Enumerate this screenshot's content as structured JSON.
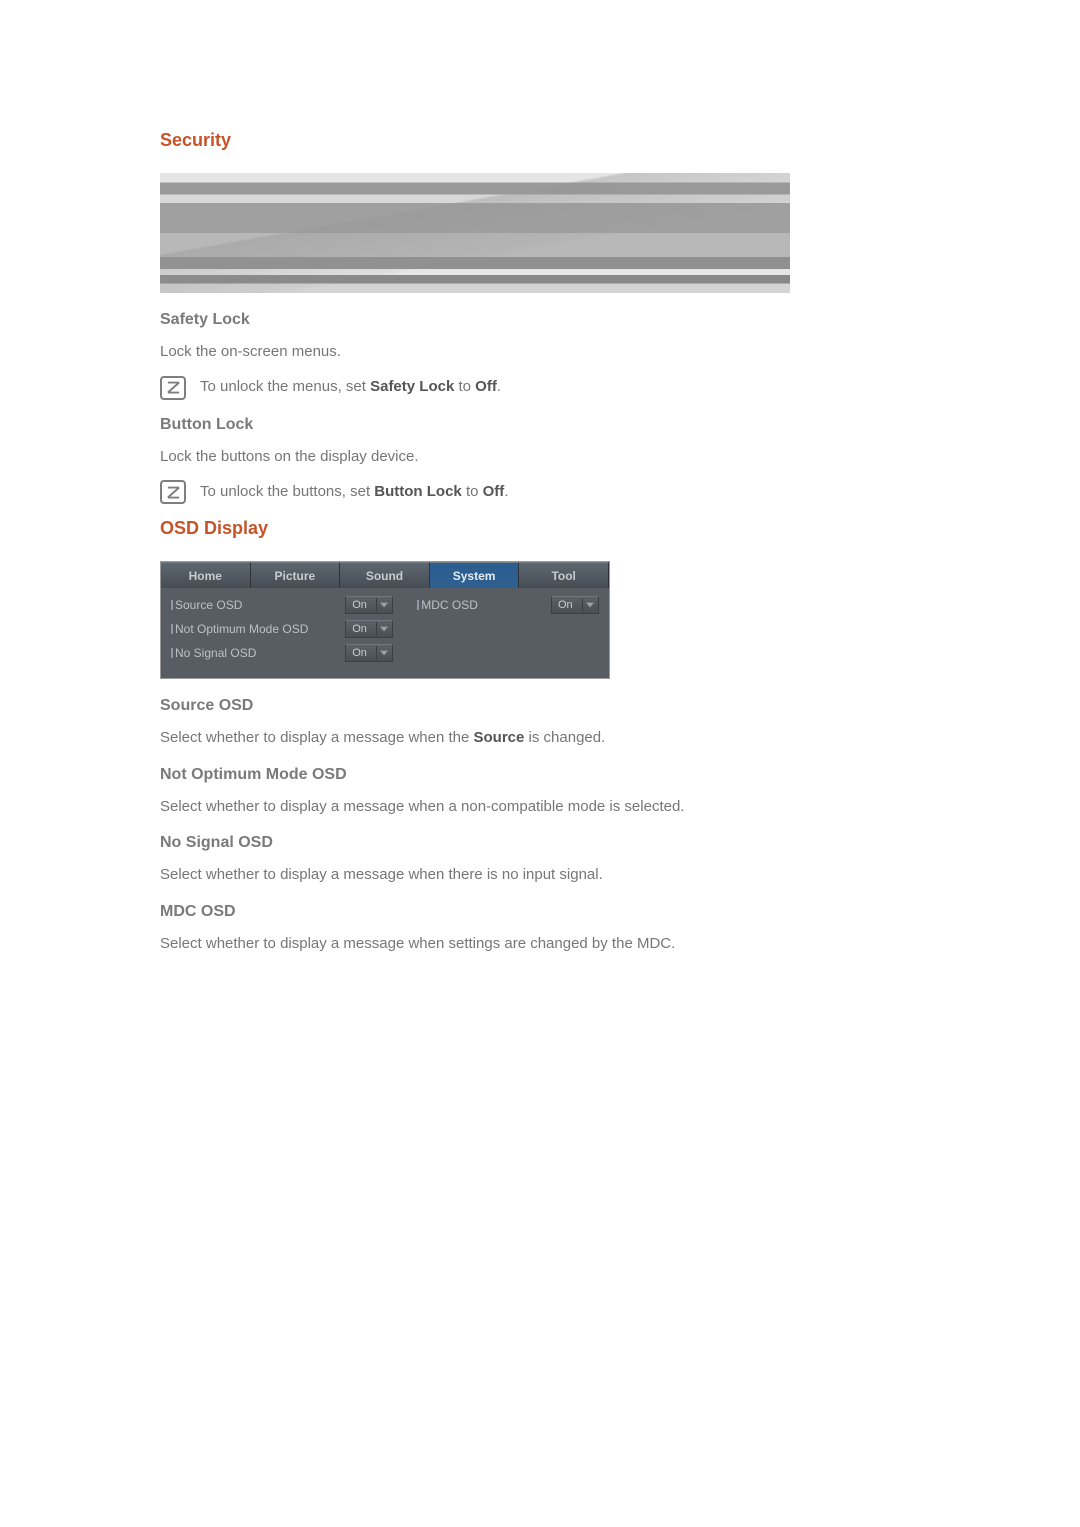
{
  "security": {
    "heading": "Security",
    "safety_lock": {
      "title": "Safety Lock",
      "desc": "Lock the on-screen menus.",
      "note_pre": "To unlock the menus, set ",
      "note_bold1": "Safety Lock",
      "note_mid": " to ",
      "note_bold2": "Off",
      "note_post": "."
    },
    "button_lock": {
      "title": "Button Lock",
      "desc": "Lock the buttons on the display device.",
      "note_pre": "To unlock the buttons, set ",
      "note_bold1": "Button Lock",
      "note_mid": " to ",
      "note_bold2": "Off",
      "note_post": "."
    }
  },
  "osd": {
    "heading": "OSD Display",
    "tabs": {
      "home": "Home",
      "picture": "Picture",
      "sound": "Sound",
      "system": "System",
      "tool": "Tool"
    },
    "rows": {
      "source_osd": {
        "label": "Source OSD",
        "value": "On"
      },
      "not_optimum": {
        "label": "Not Optimum Mode OSD",
        "value": "On"
      },
      "no_signal": {
        "label": "No Signal OSD",
        "value": "On"
      },
      "mdc_osd": {
        "label": "MDC OSD",
        "value": "On"
      }
    },
    "sections": {
      "source_osd": {
        "title": "Source OSD",
        "desc_pre": "Select whether to display a message when the ",
        "desc_bold": "Source",
        "desc_post": " is changed."
      },
      "not_optimum": {
        "title": "Not Optimum Mode OSD",
        "desc": "Select whether to display a message when a non-compatible mode is selected."
      },
      "no_signal": {
        "title": "No Signal OSD",
        "desc": "Select whether to display a message when there is no input signal."
      },
      "mdc_osd": {
        "title": "MDC OSD",
        "desc": "Select whether to display a message when settings are changed by the MDC."
      }
    }
  }
}
